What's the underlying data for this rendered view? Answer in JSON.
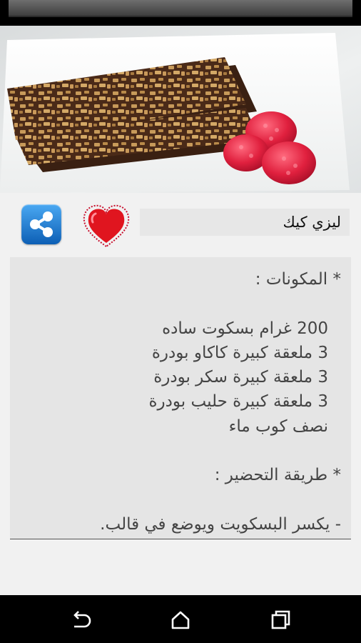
{
  "recipe": {
    "title": "ليزي كيك"
  },
  "content": {
    "ingredients_heading": "* المكونات :",
    "ingredients": [
      "200 غرام بسكوت ساده",
      "3 ملعقة كبيرة كاكاو بودرة",
      "3 ملعقة كبيرة سكر بودرة",
      "3 ملعقة كبيرة حليب بودرة",
      "نصف كوب ماء"
    ],
    "method_heading": "* طريقة التحضير :",
    "method_steps": [
      "- يكسر البسكويت ويوضع في قالب."
    ]
  },
  "icons": {
    "share": "share-icon",
    "favorite": "heart-icon",
    "back": "back-icon",
    "home": "home-icon",
    "recents": "recents-icon"
  },
  "colors": {
    "share_button": "#1a7ad4",
    "heart": "#e0151f",
    "text": "#444444"
  }
}
